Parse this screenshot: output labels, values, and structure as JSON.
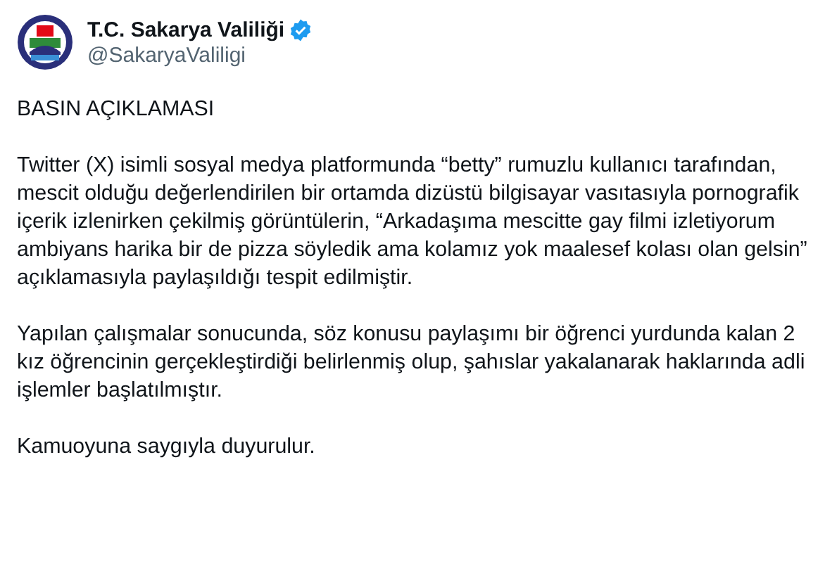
{
  "author": {
    "name": "T.C. Sakarya Valiliği",
    "verified": true,
    "handle": "@SakaryaValiligi"
  },
  "paragraphs": [
    "BASIN AÇIKLAMASI",
    "Twitter (X) isimli sosyal medya platformunda “betty” rumuzlu kullanıcı tarafından, mescit olduğu değerlendirilen bir ortamda dizüstü bilgisayar vasıtasıyla pornografik içerik izlenirken çekilmiş görüntülerin, “Arkadaşıma mescitte gay filmi izletiyorum ambiyans harika bir de pizza söyledik ama kolamız yok maalesef kolası olan gelsin” açıklamasıyla paylaşıldığı tespit edilmiştir.",
    "Yapılan çalışmalar sonucunda, söz konusu paylaşımı bir öğrenci yurdunda kalan 2 kız öğrencinin gerçekleştirdiği belirlenmiş olup, şahıslar yakalanarak haklarında adli işlemler başlatılmıştır.",
    "Kamuoyuna saygıyla duyurulur."
  ]
}
